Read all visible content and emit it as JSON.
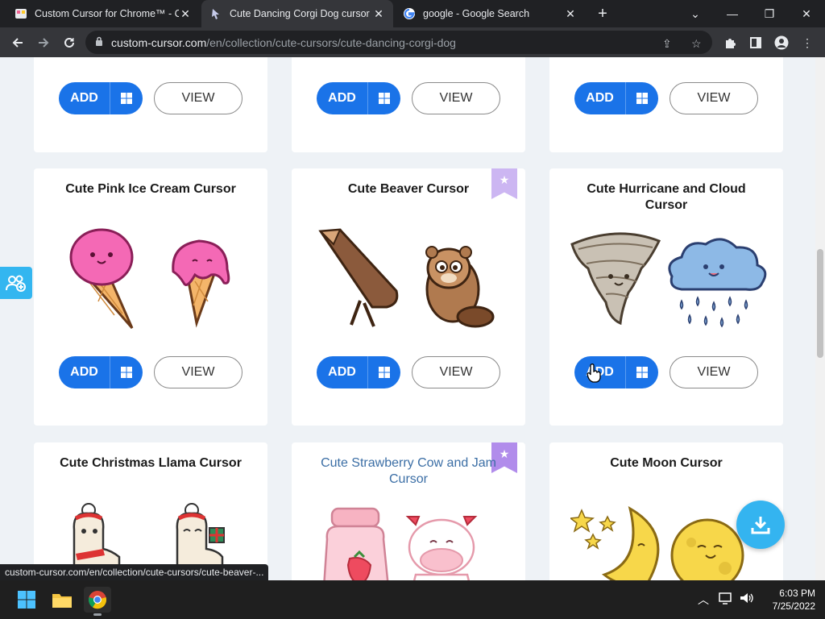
{
  "browser": {
    "tabs": [
      {
        "title": "Custom Cursor for Chrome™ - Ch",
        "active": false
      },
      {
        "title": "Cute Dancing Corgi Dog cursor –",
        "active": true
      },
      {
        "title": "google - Google Search",
        "active": false
      }
    ],
    "new_tab": "+",
    "url_host": "custom-cursor.com",
    "url_path": "/en/collection/cute-cursors/cute-dancing-corgi-dog"
  },
  "page": {
    "add_label": "ADD",
    "view_label": "VIEW",
    "cards_row1": [
      {
        "title": ""
      },
      {
        "title": ""
      },
      {
        "title": ""
      }
    ],
    "cards_row2": [
      {
        "title": "Cute Pink Ice Cream Cursor",
        "featured": false
      },
      {
        "title": "Cute Beaver Cursor",
        "featured": true
      },
      {
        "title": "Cute Hurricane and Cloud Cursor",
        "featured": false
      }
    ],
    "cards_row3": [
      {
        "title": "Cute Christmas Llama Cursor",
        "featured": false
      },
      {
        "title": "Cute Strawberry Cow and Jam Cursor",
        "featured": true
      },
      {
        "title": "Cute Moon Cursor",
        "featured": false
      }
    ],
    "status_link": "custom-cursor.com/en/collection/cute-cursors/cute-beaver-..."
  },
  "taskbar": {
    "time": "6:03 PM",
    "date": "7/25/2022"
  },
  "colors": {
    "accent": "#1a73e8",
    "featured_ribbon": "#b18ceb",
    "widget": "#34b4f0"
  }
}
